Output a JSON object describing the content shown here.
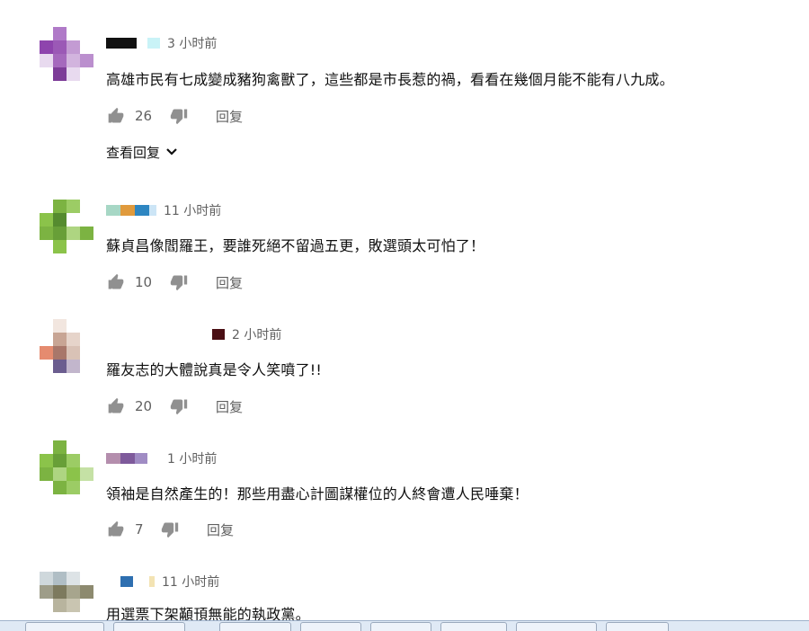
{
  "comments": [
    {
      "time": "3 小时前",
      "text": "高雄市民有七成變成豬狗禽獸了，這些都是市長惹的禍，看看在幾個月能不能有八九成。",
      "likes": "26",
      "reply_label": "回复",
      "view_replies_label": "查看回复"
    },
    {
      "time": "11 小时前",
      "text": "蘇貞昌像閻羅王，要誰死絕不留過五更，敗選頭太可怕了！",
      "likes": "10",
      "reply_label": "回复"
    },
    {
      "time": "2 小时前",
      "text": "羅友志的大體說真是令人笑噴了!!",
      "likes": "20",
      "reply_label": "回复"
    },
    {
      "time": "1 小时前",
      "text": "領袖是自然產生的！那些用盡心計圖謀權位的人終會遭人民唾棄！",
      "likes": "7",
      "reply_label": "回复"
    },
    {
      "time": "11 小时前",
      "text": "用選票下架顢頇無能的執政黨。"
    }
  ],
  "colors": {
    "text": "#0f0f0f",
    "secondary": "#606060",
    "icon": "#909090",
    "taskbar": "#dfe9f5"
  },
  "icons": {
    "like": "thumb-up-icon",
    "dislike": "thumb-down-icon",
    "expand": "chevron-down-icon"
  }
}
